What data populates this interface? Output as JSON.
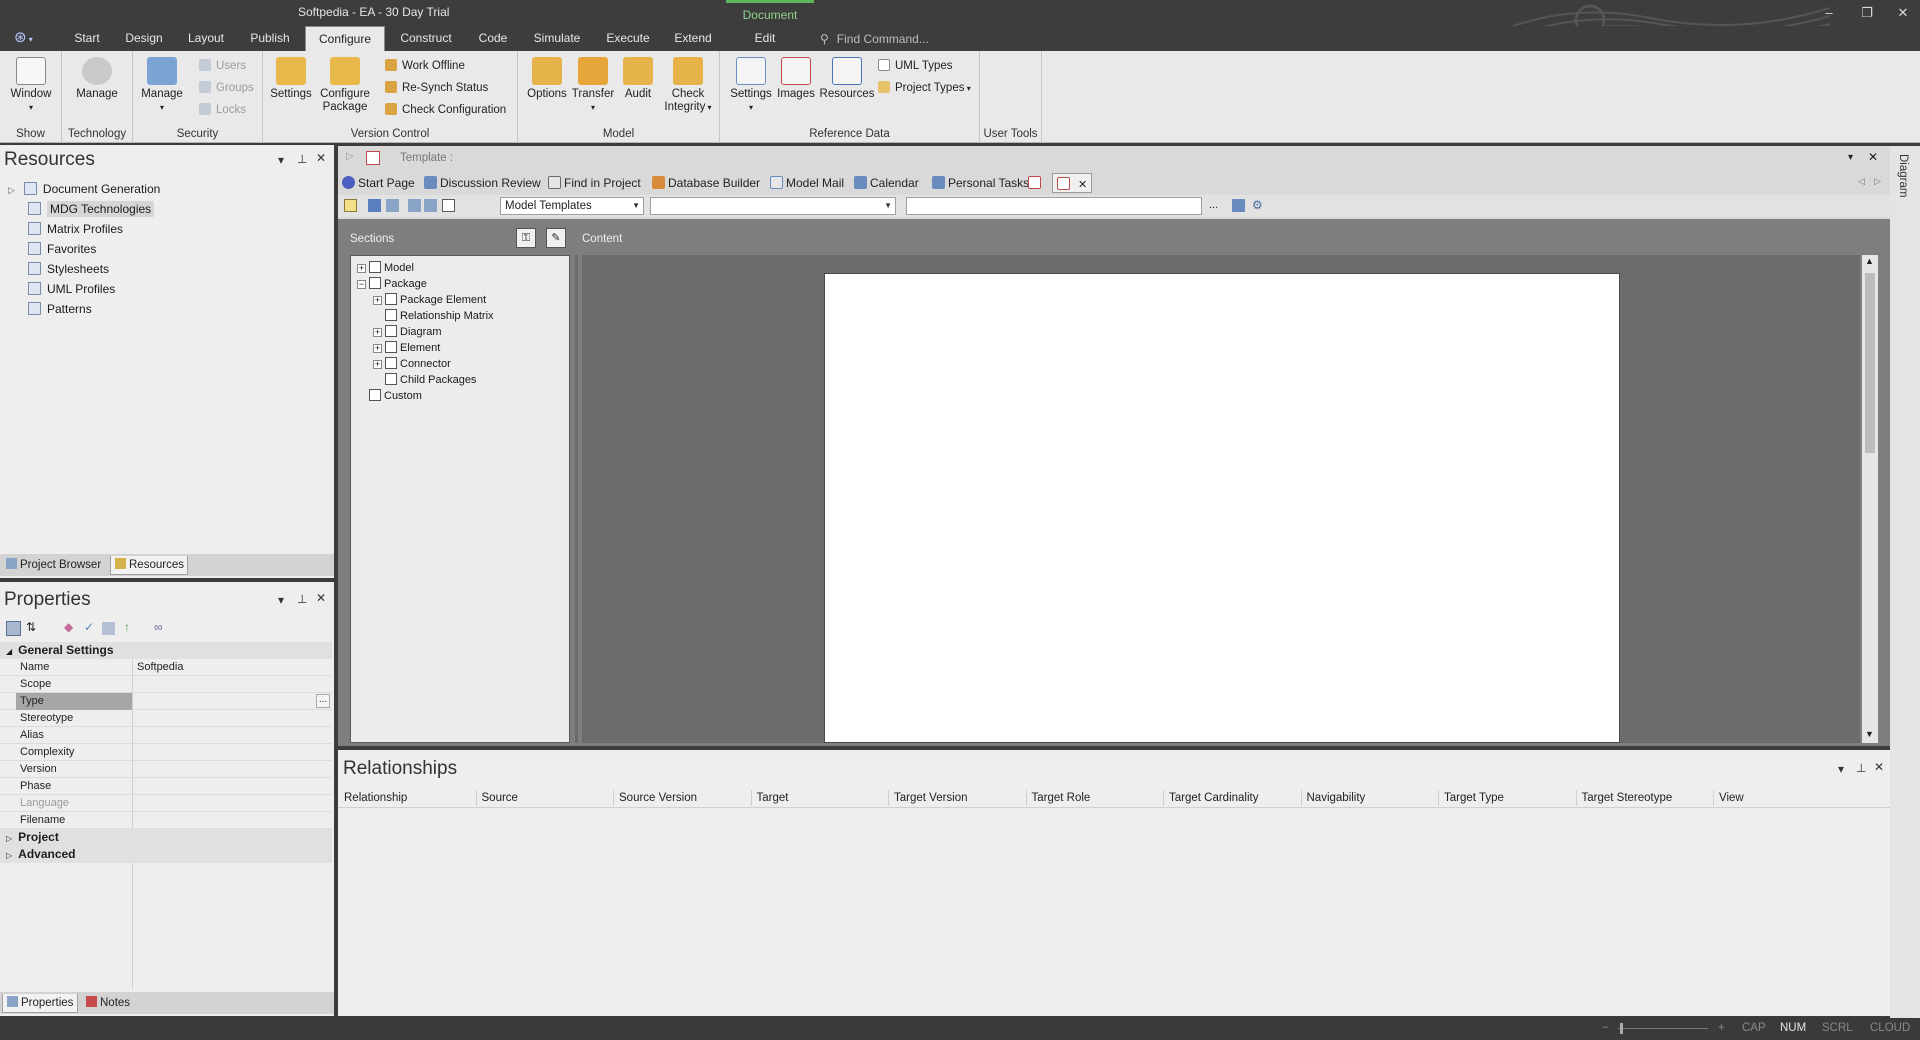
{
  "window": {
    "title": "Softpedia - EA - 30 Day Trial",
    "context_tab": "Document",
    "minimize": "–",
    "maximize": "❐",
    "close": "✕"
  },
  "menu": {
    "app_icon": "ea-logo-icon",
    "tabs": [
      "Start",
      "Design",
      "Layout",
      "Publish",
      "Configure",
      "Construct",
      "Code",
      "Simulate",
      "Execute",
      "Extend",
      "Edit"
    ],
    "active_tab": "Configure",
    "find_command": "Find Command..."
  },
  "ribbon": {
    "show": {
      "label": "Show",
      "window": "Window"
    },
    "technology": {
      "label": "Technology",
      "manage": "Manage"
    },
    "security": {
      "label": "Security",
      "manage": "Manage",
      "users": "Users",
      "groups": "Groups",
      "locks": "Locks"
    },
    "version_control": {
      "label": "Version Control",
      "settings": "Settings",
      "configure_package_1": "Configure",
      "configure_package_2": "Package",
      "work_offline": "Work Offline",
      "resynch": "Re-Synch Status",
      "check_config": "Check Configuration"
    },
    "model": {
      "label": "Model",
      "options": "Options",
      "transfer": "Transfer",
      "audit": "Audit",
      "check_integrity_1": "Check",
      "check_integrity_2": "Integrity"
    },
    "reference_data": {
      "label": "Reference Data",
      "settings": "Settings",
      "images": "Images",
      "resources": "Resources",
      "uml_types": "UML Types",
      "project_types": "Project Types"
    },
    "user_tools": {
      "label": "User Tools"
    }
  },
  "resources_panel": {
    "title": "Resources",
    "items": [
      {
        "label": "Document Generation",
        "expandable": true
      },
      {
        "label": "MDG Technologies",
        "selected": true
      },
      {
        "label": "Matrix Profiles"
      },
      {
        "label": "Favorites"
      },
      {
        "label": "Stylesheets"
      },
      {
        "label": "UML Profiles"
      },
      {
        "label": "Patterns"
      }
    ],
    "tabs": [
      "Project Browser",
      "Resources"
    ]
  },
  "properties_panel": {
    "title": "Properties",
    "section_general": "General Settings",
    "rows": [
      {
        "name": "Name",
        "value": "Softpedia"
      },
      {
        "name": "Scope",
        "value": ""
      },
      {
        "name": "Type",
        "value": "",
        "selected": true
      },
      {
        "name": "Stereotype",
        "value": ""
      },
      {
        "name": "Alias",
        "value": ""
      },
      {
        "name": "Complexity",
        "value": ""
      },
      {
        "name": "Version",
        "value": ""
      },
      {
        "name": "Phase",
        "value": ""
      },
      {
        "name": "Language",
        "value": "",
        "disabled": true
      },
      {
        "name": "Filename",
        "value": ""
      }
    ],
    "section_project": "Project",
    "section_advanced": "Advanced",
    "tabs": [
      "Properties",
      "Notes"
    ],
    "ellipsis": "..."
  },
  "document": {
    "template_label": "Template :",
    "tabs": [
      "Start Page",
      "Discussion Review",
      "Find in Project",
      "Database Builder",
      "Model Mail",
      "Calendar",
      "Personal Tasks"
    ],
    "combo_templates": "Model Templates",
    "sections_label": "Sections",
    "content_label": "Content",
    "side_tab": "Diagram",
    "ellipsis": "...",
    "tree": [
      {
        "label": "Model",
        "level": 0,
        "toggle": "+"
      },
      {
        "label": "Package",
        "level": 0,
        "toggle": "−"
      },
      {
        "label": "Package Element",
        "level": 1,
        "toggle": "+"
      },
      {
        "label": "Relationship Matrix",
        "level": 1,
        "toggle": ""
      },
      {
        "label": "Diagram",
        "level": 1,
        "toggle": "+"
      },
      {
        "label": "Element",
        "level": 1,
        "toggle": "+"
      },
      {
        "label": "Connector",
        "level": 1,
        "toggle": "+"
      },
      {
        "label": "Child Packages",
        "level": 1,
        "toggle": ""
      },
      {
        "label": "Custom",
        "level": 0,
        "toggle": ""
      }
    ]
  },
  "relationships": {
    "title": "Relationships",
    "columns": [
      "Relationship",
      "Source",
      "Source Version",
      "Target",
      "Target Version",
      "Target Role",
      "Target Cardinality",
      "Navigability",
      "Target Type",
      "Target Stereotype",
      "View"
    ]
  },
  "statusbar": {
    "minus": "−",
    "plus": "+",
    "cap": "CAP",
    "num": "NUM",
    "scrl": "SCRL",
    "cloud": "CLOUD"
  },
  "colors": {
    "titlebar": "#3d3d3d",
    "ribbon": "#e9e9e9",
    "panel": "#eeeeee",
    "accent_green": "#5fb55a",
    "doc_dark": "#808080"
  }
}
